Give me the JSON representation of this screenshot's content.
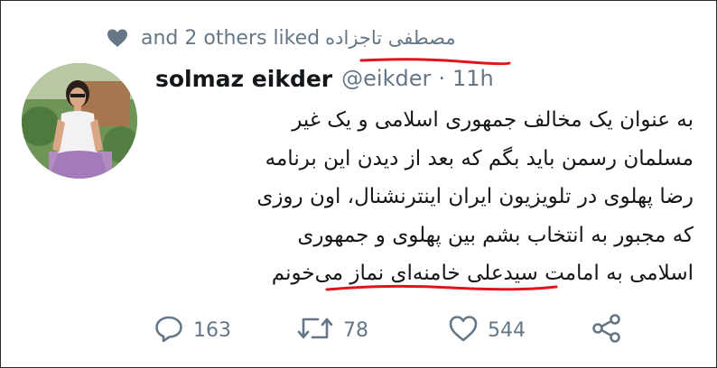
{
  "social_context": {
    "icon": "heart-icon",
    "liker_name": "مصطفی تاجزاده",
    "text": "and 2 others liked"
  },
  "tweet": {
    "author_name": "solmaz eikder",
    "handle": "@eikder",
    "separator": "·",
    "time": "11h",
    "lines": [
      "به عنوان یک مخالف جمهوری اسلامی و یک غیر",
      "مسلمان رسمن باید بگم که بعد از دیدن این برنامه",
      "رضا پهلوی در تلویزیون ایران اینترنشنال، اون روزی",
      "که مجبور به انتخاب بشم بین پهلوی و جمهوری",
      "اسلامی به امامت سیدعلی خامنه‌ای نماز می‌خونم"
    ]
  },
  "actions": {
    "reply": {
      "icon": "reply-icon",
      "count": "163"
    },
    "retweet": {
      "icon": "retweet-icon",
      "count": "78"
    },
    "like": {
      "icon": "heart-outline-icon",
      "count": "544"
    },
    "share": {
      "icon": "share-icon"
    }
  },
  "colors": {
    "muted": "#657786",
    "text": "#14171a",
    "annotation_red": "#e0151b"
  }
}
